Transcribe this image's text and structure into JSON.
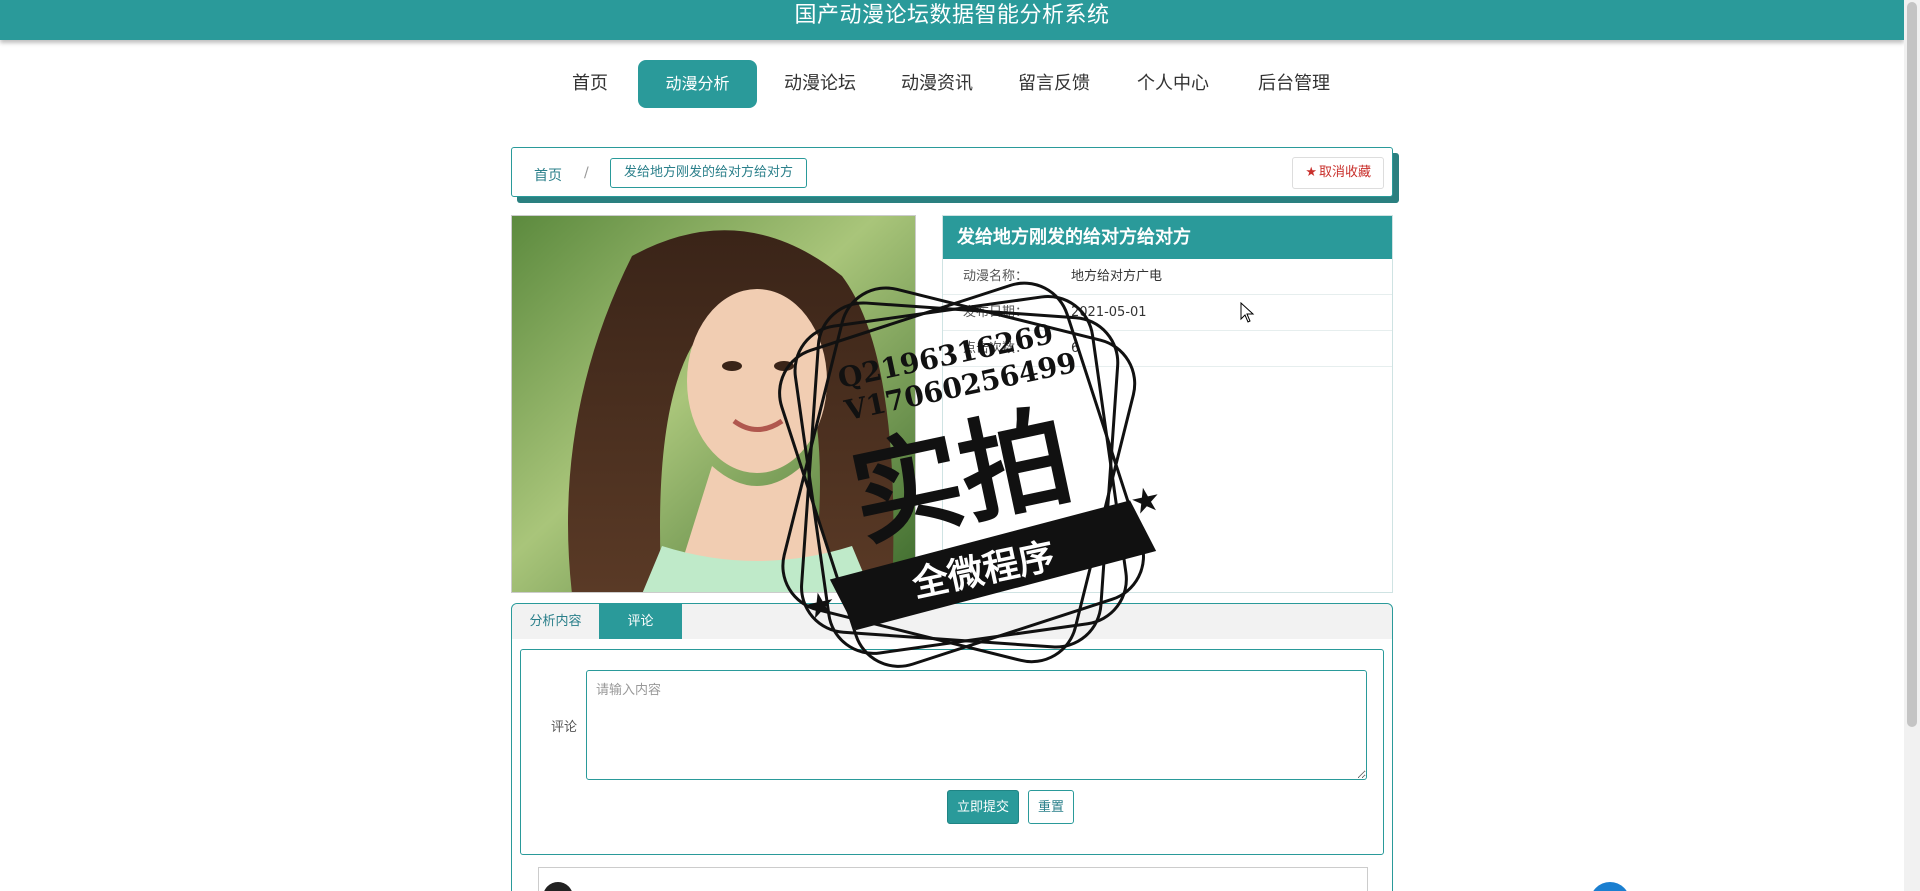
{
  "header": {
    "title": "国产动漫论坛数据智能分析系统"
  },
  "nav": {
    "items": [
      {
        "label": "首页"
      },
      {
        "label": "动漫分析"
      },
      {
        "label": "动漫论坛"
      },
      {
        "label": "动漫资讯"
      },
      {
        "label": "留言反馈"
      },
      {
        "label": "个人中心"
      },
      {
        "label": "后台管理"
      }
    ],
    "active_index": 1
  },
  "breadcrumb": {
    "home": "首页",
    "separator": "/",
    "current": "发给地方刚发的给对方给对方"
  },
  "favorite": {
    "icon": "star-icon",
    "label": "取消收藏"
  },
  "detail": {
    "title": "发给地方刚发的给对方给对方",
    "fields": [
      {
        "label": "动漫名称：",
        "value": "地方给对方广电"
      },
      {
        "label": "发布日期：",
        "value": "2021-05-01"
      },
      {
        "label": "点击次数：",
        "value": "6"
      }
    ]
  },
  "tabs": [
    {
      "label": "分析内容"
    },
    {
      "label": "评论"
    }
  ],
  "comment_form": {
    "label": "评论",
    "placeholder": "请输入内容",
    "submit_label": "立即提交",
    "reset_label": "重置"
  },
  "watermark": {
    "line1": "Q2196316269",
    "line2": "V17060256499",
    "main": "实拍",
    "ribbon": "全微程序"
  },
  "colors": {
    "accent": "#2a9a9a",
    "danger": "#c9302c"
  }
}
